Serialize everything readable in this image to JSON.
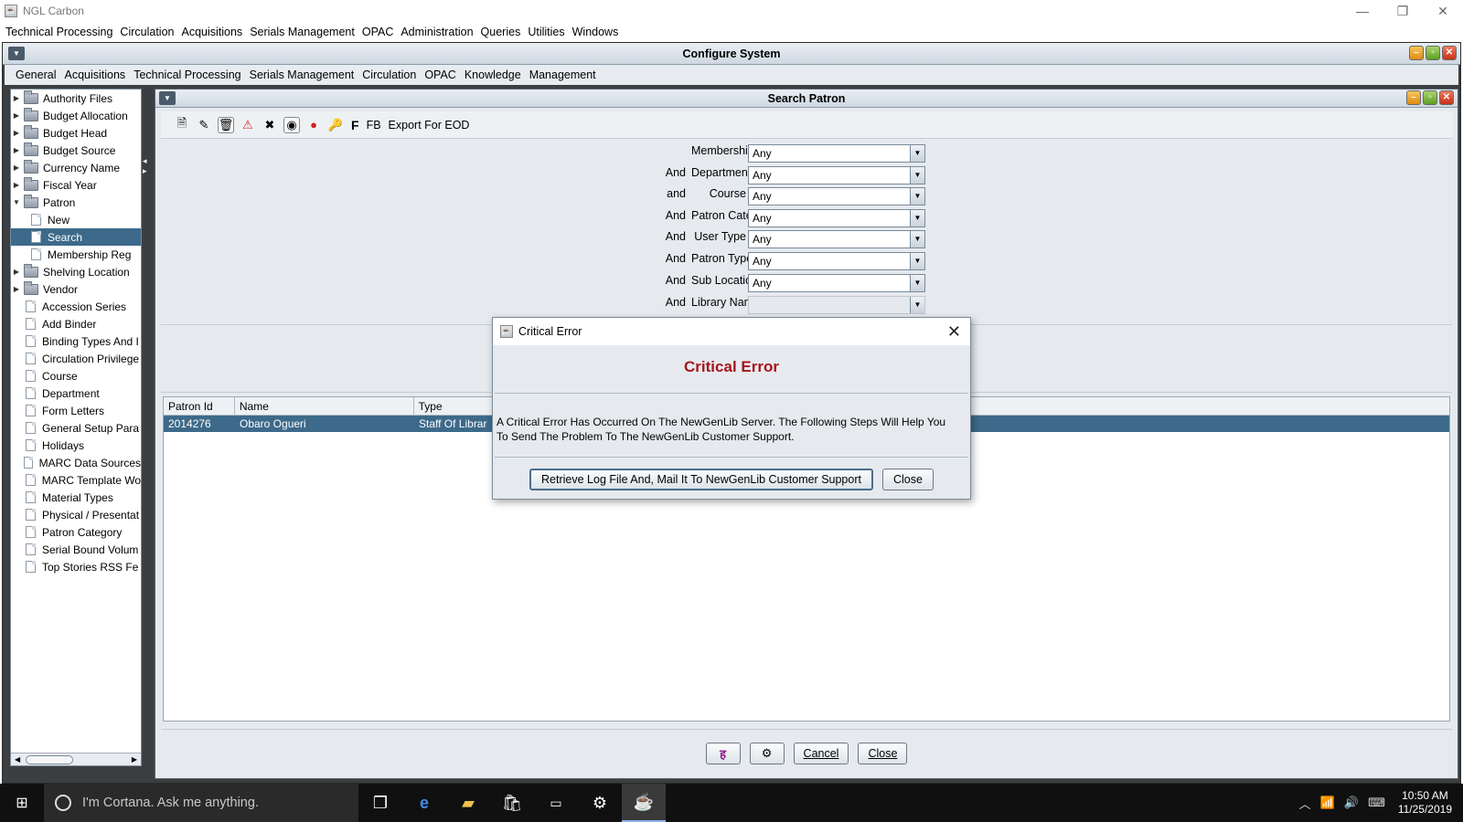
{
  "app": {
    "title": "NGL Carbon",
    "icon": "java-cup-icon",
    "controls": [
      "—",
      "❐",
      "✕"
    ]
  },
  "menubar": [
    "Technical Processing",
    "Circulation",
    "Acquisitions",
    "Serials Management",
    "OPAC",
    "Administration",
    "Queries",
    "Utilities",
    "Windows"
  ],
  "configure_system": {
    "title": "Configure System",
    "menus": [
      "General",
      "Acquisitions",
      "Technical Processing",
      "Serials Management",
      "Circulation",
      "OPAC",
      "Knowledge",
      "Management"
    ]
  },
  "tree": [
    {
      "label": "Authority Files",
      "type": "folder",
      "expanded": false
    },
    {
      "label": "Budget Allocation",
      "type": "folder",
      "expanded": false
    },
    {
      "label": "Budget Head",
      "type": "folder",
      "expanded": false
    },
    {
      "label": "Budget Source",
      "type": "folder",
      "expanded": false
    },
    {
      "label": "Currency Name",
      "type": "folder",
      "expanded": false
    },
    {
      "label": "Fiscal Year",
      "type": "folder",
      "expanded": false
    },
    {
      "label": "Patron",
      "type": "folder",
      "expanded": true
    },
    {
      "label": "New",
      "type": "leaf-child"
    },
    {
      "label": "Search",
      "type": "leaf-child",
      "selected": true
    },
    {
      "label": "Membership Reg",
      "type": "leaf-child"
    },
    {
      "label": "Shelving Location",
      "type": "folder",
      "expanded": false
    },
    {
      "label": "Vendor",
      "type": "folder",
      "expanded": false
    },
    {
      "label": "Accession Series",
      "type": "leaf"
    },
    {
      "label": "Add Binder",
      "type": "leaf"
    },
    {
      "label": "Binding Types And I",
      "type": "leaf"
    },
    {
      "label": "Circulation Privilege",
      "type": "leaf"
    },
    {
      "label": "Course",
      "type": "leaf"
    },
    {
      "label": "Department",
      "type": "leaf"
    },
    {
      "label": "Form Letters",
      "type": "leaf"
    },
    {
      "label": "General Setup Para",
      "type": "leaf"
    },
    {
      "label": "Holidays",
      "type": "leaf"
    },
    {
      "label": "MARC Data Sources",
      "type": "leaf"
    },
    {
      "label": "MARC Template Wo",
      "type": "leaf"
    },
    {
      "label": "Material Types",
      "type": "leaf"
    },
    {
      "label": "Physical / Presentat",
      "type": "leaf"
    },
    {
      "label": "Patron Category",
      "type": "leaf"
    },
    {
      "label": "Serial Bound Volum",
      "type": "leaf"
    },
    {
      "label": "Top Stories RSS Fe",
      "type": "leaf"
    }
  ],
  "search_patron": {
    "title": "Search Patron",
    "toolbar_text": [
      "F",
      "FB",
      "Export For EOD"
    ],
    "form": [
      {
        "conj": "",
        "label": "Membership",
        "value": "Any"
      },
      {
        "conj": "And",
        "label": "Department",
        "value": "Any"
      },
      {
        "conj": "and",
        "label": "Course",
        "value": "Any"
      },
      {
        "conj": "And",
        "label": "Patron Category",
        "value": "Any"
      },
      {
        "conj": "And",
        "label": "User Type",
        "value": "Any"
      },
      {
        "conj": "And",
        "label": "Patron Type",
        "value": "Any"
      },
      {
        "conj": "And",
        "label": "Sub Location",
        "value": "Any"
      },
      {
        "conj": "And",
        "label": "Library Name",
        "value": ""
      }
    ],
    "table": {
      "columns": [
        "Patron Id",
        "Name",
        "Type"
      ],
      "rows": [
        [
          "2014276",
          "Obaro  Ogueri",
          "Staff Of Librar"
        ]
      ]
    },
    "buttons": {
      "cancel": "Cancel",
      "close": "Close"
    }
  },
  "dialog": {
    "title": "Critical Error",
    "heading": "Critical Error",
    "message_line1": "A Critical Error Has Occurred On The NewGenLib Server. The Following Steps Will Help You",
    "message_line2": "To Send The Problem To The NewGenLib Customer Support.",
    "retrieve_button": "Retrieve Log File And, Mail It To NewGenLib Customer Support",
    "close_button": "Close",
    "accent_color": "#a8141c"
  },
  "taskbar": {
    "cortana_placeholder": "I'm Cortana. Ask me anything.",
    "time": "10:50 AM",
    "date": "11/25/2019"
  }
}
